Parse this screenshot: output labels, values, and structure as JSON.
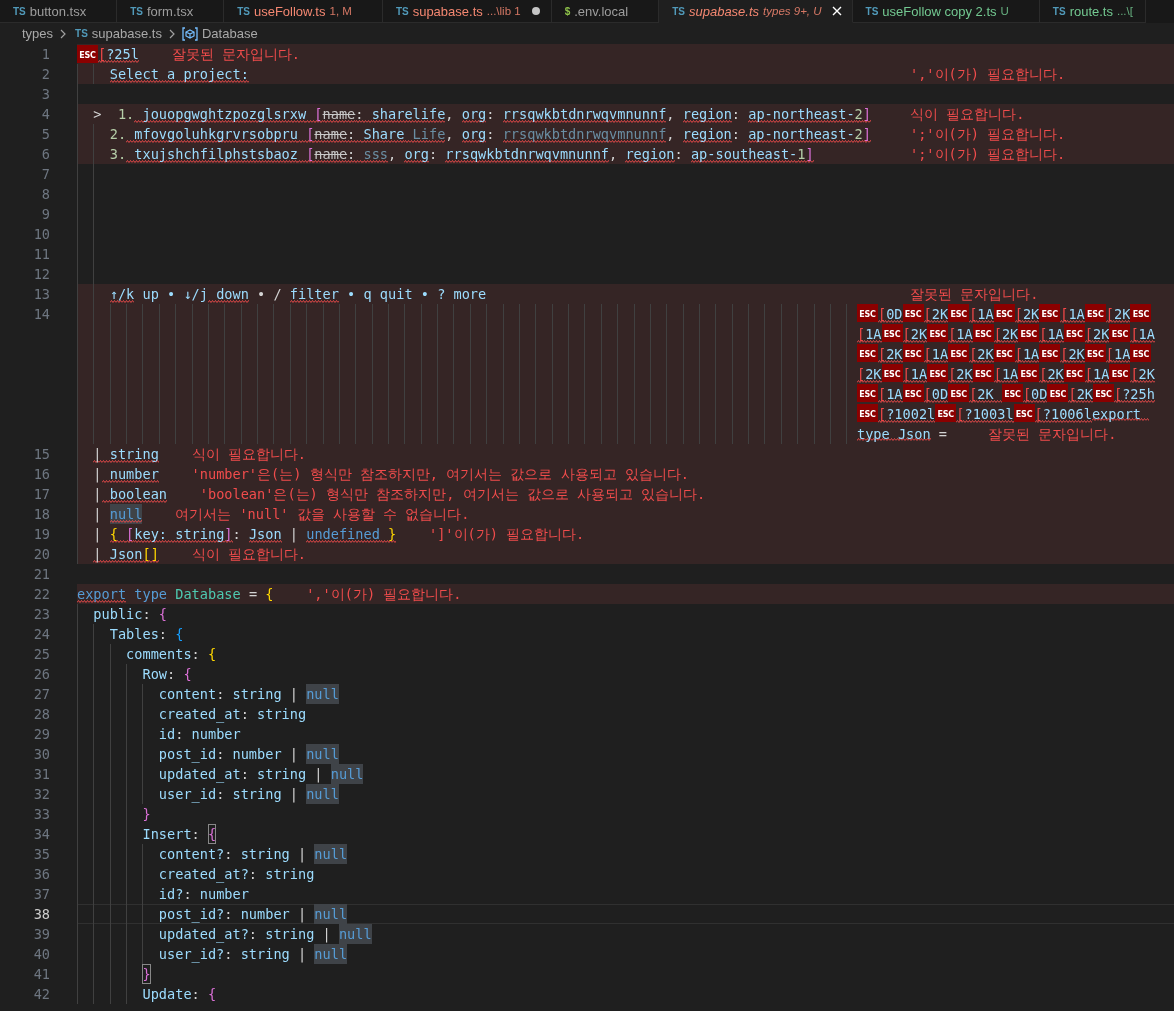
{
  "tabs": [
    {
      "icon": "TS",
      "kind": "ts",
      "label": "button.tsx",
      "color": "#9d9d9d",
      "dirty": false,
      "preview": false,
      "selected": false
    },
    {
      "icon": "TS",
      "kind": "ts",
      "label": "form.tsx",
      "color": "#9d9d9d",
      "dirty": false,
      "preview": false,
      "selected": false
    },
    {
      "icon": "TS",
      "kind": "ts",
      "label": "useFollow.ts",
      "detail": "1, M",
      "color": "#f48771",
      "dirty": false,
      "preview": false,
      "selected": false
    },
    {
      "icon": "TS",
      "kind": "ts",
      "label": "supabase.ts",
      "detail": "...\\lib 1",
      "color": "#f48771",
      "dirty": true,
      "preview": false,
      "selected": false
    },
    {
      "icon": "$",
      "kind": "shell",
      "label": ".env.local",
      "color": "#9d9d9d",
      "dirty": false,
      "preview": false,
      "selected": false
    },
    {
      "icon": "TS",
      "kind": "ts",
      "label": "supabase.ts",
      "detail": "types 9+, U",
      "color": "#f48771",
      "dirty": false,
      "preview": true,
      "selected": true
    },
    {
      "icon": "TS",
      "kind": "ts",
      "label": "useFollow copy 2.ts",
      "detail": "U",
      "color": "#73c991",
      "dirty": false,
      "preview": false,
      "selected": false
    },
    {
      "icon": "TS",
      "kind": "ts",
      "label": "route.ts",
      "detail": "...\\[",
      "color": "#73c991",
      "dirty": false,
      "preview": false,
      "selected": false
    }
  ],
  "breadcrumb": [
    {
      "kind": "folder",
      "label": "types"
    },
    {
      "kind": "file",
      "icon": "TS",
      "label": "supabase.ts"
    },
    {
      "kind": "symbol",
      "label": "Database"
    }
  ],
  "lines": [
    {
      "number": "1",
      "error": true,
      "current": false,
      "tokens": [
        {
          "kind": "escape",
          "control": "ESC",
          "text": "[?25l",
          "squiggle": true
        }
      ],
      "diagnostic": {
        "message": "잘못된 문자입니다.",
        "kind": "inline"
      }
    },
    {
      "number": "2",
      "error": true,
      "current": false,
      "tokens": [
        {
          "text": "    Select a project:",
          "kind": "name",
          "squiggle": true
        }
      ],
      "diagnostic": {
        "message": "','이(가) 필요합니다.",
        "kind": "end"
      }
    },
    {
      "number": "3",
      "error": false,
      "current": false
    },
    {
      "number": "4",
      "error": true,
      "current": false,
      "tokens": [
        {
          "text": "  >  ",
          "kind": "plain",
          "squiggle": false
        },
        {
          "text": "1.",
          "kind": "number",
          "squiggle": false
        },
        {
          "text": " jouopgwghtzpozglsrxw",
          "kind": "name",
          "squiggle": true
        },
        {
          "text": " [",
          "kind": "bracket",
          "squiggle": true
        },
        {
          "text": "name",
          "kind": "deprecated",
          "squiggle": true
        },
        {
          "text": ": ",
          "kind": "plain",
          "squiggle": true
        },
        {
          "text": "sharelife",
          "kind": "name",
          "squiggle": true
        },
        {
          "text": ", ",
          "kind": "plain",
          "squiggle": false
        },
        {
          "text": "org",
          "kind": "name",
          "squiggle": true
        },
        {
          "text": ": ",
          "kind": "plain",
          "squiggle": false
        },
        {
          "text": "rrsqwkbtdnrwqvmnunnf",
          "kind": "name",
          "squiggle": true
        },
        {
          "text": ", ",
          "kind": "plain",
          "squiggle": false
        },
        {
          "text": "region",
          "kind": "name",
          "squiggle": true
        },
        {
          "text": ": ",
          "kind": "plain",
          "squiggle": false
        },
        {
          "text": "ap-northeast-",
          "kind": "name",
          "squiggle": true
        },
        {
          "text": "2",
          "kind": "number",
          "squiggle": true
        },
        {
          "text": "]",
          "kind": "bracket",
          "squiggle": true
        }
      ],
      "diagnostic": {
        "message": "식이 필요합니다.",
        "kind": "end"
      }
    },
    {
      "number": "5",
      "error": true,
      "current": false,
      "tokens": [
        {
          "text": "    2.",
          "kind": "number",
          "squiggle": false
        },
        {
          "text": " mfovgoluhkgrvrsobpru",
          "kind": "name",
          "squiggle": true
        },
        {
          "text": " [",
          "kind": "bracket",
          "squiggle": true
        },
        {
          "text": "name",
          "kind": "deprecated",
          "squiggle": true
        },
        {
          "text": ": ",
          "kind": "plain",
          "squiggle": true
        },
        {
          "text": "Share",
          "kind": "name",
          "squiggle": true
        },
        {
          "text": " Life",
          "kind": "dim",
          "squiggle": true
        },
        {
          "text": ", ",
          "kind": "plain",
          "squiggle": false
        },
        {
          "text": "org",
          "kind": "name",
          "squiggle": true
        },
        {
          "text": ": ",
          "kind": "plain",
          "squiggle": false
        },
        {
          "text": "rrsqwkbtdnrwqvmnunnf",
          "kind": "dim",
          "squiggle": true
        },
        {
          "text": ", ",
          "kind": "plain",
          "squiggle": false
        },
        {
          "text": "region",
          "kind": "name",
          "squiggle": true
        },
        {
          "text": ": ",
          "kind": "plain",
          "squiggle": false
        },
        {
          "text": "ap-northeast-",
          "kind": "name",
          "squiggle": true
        },
        {
          "text": "2",
          "kind": "number",
          "squiggle": true
        },
        {
          "text": "]",
          "kind": "bracket",
          "squiggle": true
        }
      ],
      "diagnostic": {
        "message": "';'이(가) 필요합니다.",
        "kind": "end"
      }
    },
    {
      "number": "6",
      "error": true,
      "current": false,
      "tokens": [
        {
          "text": "    3.",
          "kind": "number",
          "squiggle": false
        },
        {
          "text": " txujshchfilphstsbaoz",
          "kind": "name",
          "squiggle": true
        },
        {
          "text": " [",
          "kind": "bracket",
          "squiggle": true
        },
        {
          "text": "name",
          "kind": "deprecated",
          "squiggle": true
        },
        {
          "text": ": ",
          "kind": "plain",
          "squiggle": true
        },
        {
          "text": "sss",
          "kind": "dim",
          "squiggle": true
        },
        {
          "text": ", ",
          "kind": "plain",
          "squiggle": false
        },
        {
          "text": "org",
          "kind": "name",
          "squiggle": true
        },
        {
          "text": ": ",
          "kind": "plain",
          "squiggle": false
        },
        {
          "text": "rrsqwkbtdnrwqvmnunnf",
          "kind": "name",
          "squiggle": true
        },
        {
          "text": ", ",
          "kind": "plain",
          "squiggle": false
        },
        {
          "text": "region",
          "kind": "name",
          "squiggle": true
        },
        {
          "text": ": ",
          "kind": "plain",
          "squiggle": false
        },
        {
          "text": "ap-southeast-",
          "kind": "name",
          "squiggle": true
        },
        {
          "text": "1",
          "kind": "number",
          "squiggle": true
        },
        {
          "text": "]",
          "kind": "bracket",
          "squiggle": true
        }
      ],
      "diagnostic": {
        "message": "';'이(가) 필요합니다.",
        "kind": "end"
      }
    },
    {
      "number": "7",
      "error": false,
      "current": false
    },
    {
      "number": "8",
      "error": false,
      "current": false
    },
    {
      "number": "9",
      "error": false,
      "current": false
    },
    {
      "number": "10",
      "error": false,
      "current": false
    },
    {
      "number": "11",
      "error": false,
      "current": false
    },
    {
      "number": "12",
      "error": false,
      "current": false
    },
    {
      "number": "13",
      "error": true,
      "current": false,
      "tokens": [
        {
          "text": "    ↑/k",
          "kind": "name",
          "squiggle": true
        },
        {
          "text": " up • ",
          "kind": "name",
          "squiggle": false
        },
        {
          "text": "↓/j",
          "kind": "name",
          "squiggle": false
        },
        {
          "text": " down",
          "kind": "name",
          "squiggle": true
        },
        {
          "text": " • / ",
          "kind": "plain",
          "squiggle": false
        },
        {
          "text": "filter",
          "kind": "name",
          "squiggle": true
        },
        {
          "text": " • q quit • ? more",
          "kind": "name",
          "squiggle": false
        }
      ],
      "diagnostic": {
        "message": "잘못된 문자입니다.",
        "kind": "end"
      }
    },
    {
      "number": "14",
      "error": true,
      "current": false,
      "wrapped": true,
      "tokens": [
        {
          "kind": "escape",
          "control": "ESC",
          "text": "[0D",
          "squiggle": true
        },
        {
          "kind": "escape",
          "control": "ESC",
          "text": "[2K",
          "squiggle": true
        },
        {
          "kind": "escape",
          "control": "ESC",
          "text": "[1A",
          "squiggle": true
        },
        {
          "kind": "escape",
          "control": "ESC",
          "text": "[2K",
          "squiggle": true
        },
        {
          "kind": "escape",
          "control": "ESC",
          "text": "[1A",
          "squiggle": true
        },
        {
          "kind": "escape",
          "control": "ESC",
          "text": "[2K",
          "squiggle": true
        },
        {
          "kind": "escape",
          "control": "ESC",
          "text": "[1A",
          "squiggle": true
        },
        {
          "kind": "escape",
          "control": "ESC",
          "text": "[2K",
          "squiggle": true
        },
        {
          "kind": "escape",
          "control": "ESC",
          "text": "[1A",
          "squiggle": true
        },
        {
          "kind": "escape",
          "control": "ESC",
          "text": "[2K",
          "squiggle": true
        },
        {
          "kind": "escape",
          "control": "ESC",
          "text": "[1A",
          "squiggle": true
        },
        {
          "kind": "escape",
          "control": "ESC",
          "text": "[2K",
          "squiggle": true
        },
        {
          "kind": "escape",
          "control": "ESC",
          "text": "[1A",
          "squiggle": true
        },
        {
          "kind": "escape",
          "control": "ESC",
          "text": "[2K",
          "squiggle": true
        },
        {
          "kind": "escape",
          "control": "ESC",
          "text": "[1A",
          "squiggle": true
        },
        {
          "kind": "escape",
          "control": "ESC",
          "text": "[2K",
          "squiggle": true
        },
        {
          "kind": "escape",
          "control": "ESC",
          "text": "[1A",
          "squiggle": true
        },
        {
          "kind": "escape",
          "control": "ESC",
          "text": "[2K",
          "squiggle": true
        },
        {
          "kind": "escape",
          "control": "ESC",
          "text": "[1A",
          "squiggle": true
        },
        {
          "kind": "escape",
          "control": "ESC",
          "text": "[2K",
          "squiggle": true
        },
        {
          "kind": "escape",
          "control": "ESC",
          "text": "[1A",
          "squiggle": true
        },
        {
          "kind": "escape",
          "control": "ESC",
          "text": "[2K",
          "squiggle": true
        },
        {
          "kind": "escape",
          "control": "ESC",
          "text": "[1A",
          "squiggle": true
        },
        {
          "kind": "escape",
          "control": "ESC",
          "text": "[2K",
          "squiggle": true
        },
        {
          "kind": "escape",
          "control": "ESC",
          "text": "[1A",
          "squiggle": true
        },
        {
          "kind": "escape",
          "control": "ESC",
          "text": "[2K",
          "squiggle": true
        },
        {
          "kind": "escape",
          "control": "ESC",
          "text": "[1A",
          "squiggle": true
        },
        {
          "kind": "escape",
          "control": "ESC",
          "text": "[0D",
          "squiggle": true
        },
        {
          "kind": "escape",
          "control": "ESC",
          "text": "[2K ",
          "squiggle": true
        },
        {
          "kind": "escape",
          "control": "ESC",
          "text": "[0D",
          "squiggle": true
        },
        {
          "kind": "escape",
          "control": "ESC",
          "text": "[2K",
          "squiggle": true
        },
        {
          "kind": "escape",
          "control": "ESC",
          "text": "[?25h",
          "squiggle": true
        },
        {
          "kind": "escape",
          "control": "ESC",
          "text": "[?1002l",
          "squiggle": true
        },
        {
          "kind": "escape",
          "control": "ESC",
          "text": "[?1003l",
          "squiggle": true
        },
        {
          "kind": "escape",
          "control": "ESC",
          "text": "[?1006l",
          "squiggle": true
        },
        {
          "text": "export type Json",
          "kind": "name",
          "squiggle": true
        },
        {
          "text": " =",
          "kind": "plain",
          "squiggle": false
        }
      ],
      "diagnostic": {
        "message": "잘못된 문자입니다.",
        "kind": "inline"
      }
    },
    {
      "number": "15",
      "error": true,
      "current": false,
      "tokens": [
        {
          "text": "  |",
          "kind": "plain",
          "squiggle": true
        },
        {
          "text": " string",
          "kind": "name",
          "squiggle": true
        }
      ],
      "diagnostic": {
        "message": "식이 필요합니다.",
        "kind": "inline"
      }
    },
    {
      "number": "16",
      "error": true,
      "current": false,
      "tokens": [
        {
          "text": "  |",
          "kind": "plain",
          "squiggle": false
        },
        {
          "text": " number",
          "kind": "name",
          "squiggle": true
        }
      ],
      "diagnostic": {
        "message": "'number'은(는) 형식만 참조하지만, 여기서는 값으로 사용되고 있습니다.",
        "kind": "inline"
      }
    },
    {
      "number": "17",
      "error": true,
      "current": false,
      "tokens": [
        {
          "text": "  |",
          "kind": "plain",
          "squiggle": false
        },
        {
          "text": " boolean",
          "kind": "name",
          "squiggle": true
        }
      ],
      "diagnostic": {
        "message": "'boolean'은(는) 형식만 참조하지만, 여기서는 값으로 사용되고 있습니다.",
        "kind": "inline"
      }
    },
    {
      "number": "18",
      "error": true,
      "current": false,
      "tokens": [
        {
          "text": "  | ",
          "kind": "plain",
          "squiggle": false
        },
        {
          "text": "null",
          "kind": "nullref",
          "squiggle": true
        }
      ],
      "diagnostic": {
        "message": "여기서는 'null' 값을 사용할 수 없습니다.",
        "kind": "inline"
      }
    },
    {
      "number": "19",
      "error": true,
      "current": false,
      "tokens": [
        {
          "text": "  | ",
          "kind": "plain",
          "squiggle": false
        },
        {
          "text": "{ ",
          "kind": "brace1",
          "squiggle": true
        },
        {
          "text": "[",
          "kind": "brace2",
          "squiggle": true
        },
        {
          "text": "key: string",
          "kind": "name",
          "squiggle": true
        },
        {
          "text": "]",
          "kind": "brace2",
          "squiggle": true
        },
        {
          "text": ": ",
          "kind": "plain",
          "squiggle": false
        },
        {
          "text": "Json",
          "kind": "name",
          "squiggle": true
        },
        {
          "text": " | ",
          "kind": "plain",
          "squiggle": false
        },
        {
          "text": "undefined",
          "kind": "keyword",
          "squiggle": true
        },
        {
          "text": " }",
          "kind": "brace1",
          "squiggle": true
        }
      ],
      "diagnostic": {
        "message": "']'이(가) 필요합니다.",
        "kind": "inline"
      }
    },
    {
      "number": "20",
      "error": true,
      "current": false,
      "tokens": [
        {
          "text": "  |",
          "kind": "plain",
          "squiggle": true
        },
        {
          "text": " Json",
          "kind": "name",
          "squiggle": true
        },
        {
          "text": "[]",
          "kind": "brace1",
          "squiggle": true
        }
      ],
      "diagnostic": {
        "message": "식이 필요합니다.",
        "kind": "inline"
      }
    },
    {
      "number": "21",
      "error": false,
      "current": false
    },
    {
      "number": "22",
      "error": true,
      "current": false,
      "tokens": [
        {
          "text": "export",
          "kind": "keyword",
          "squiggle": true
        },
        {
          "text": " type",
          "kind": "keyword",
          "squiggle": false
        },
        {
          "text": " Database",
          "kind": "type",
          "squiggle": false
        },
        {
          "text": " = ",
          "kind": "plain",
          "squiggle": false
        },
        {
          "text": "{",
          "kind": "brace1",
          "squiggle": false
        }
      ],
      "diagnostic": {
        "message": "','이(가) 필요합니다.",
        "kind": "inline"
      }
    },
    {
      "number": "23",
      "error": false,
      "current": false,
      "tokens": [
        {
          "text": "  public",
          "kind": "name",
          "squiggle": false
        },
        {
          "text": ": ",
          "kind": "plain",
          "squiggle": false
        },
        {
          "text": "{",
          "kind": "brace2",
          "squiggle": false
        }
      ]
    },
    {
      "number": "24",
      "error": false,
      "current": false,
      "tokens": [
        {
          "text": "    Tables",
          "kind": "name",
          "squiggle": false
        },
        {
          "text": ": ",
          "kind": "plain",
          "squiggle": false
        },
        {
          "text": "{",
          "kind": "brace3",
          "squiggle": false
        }
      ]
    },
    {
      "number": "25",
      "error": false,
      "current": false,
      "tokens": [
        {
          "text": "      comments",
          "kind": "name",
          "squiggle": false
        },
        {
          "text": ": ",
          "kind": "plain",
          "squiggle": false
        },
        {
          "text": "{",
          "kind": "brace1",
          "squiggle": false
        }
      ]
    },
    {
      "number": "26",
      "error": false,
      "current": false,
      "tokens": [
        {
          "text": "        Row",
          "kind": "name",
          "squiggle": false
        },
        {
          "text": ": ",
          "kind": "plain",
          "squiggle": false
        },
        {
          "text": "{",
          "kind": "brace2",
          "squiggle": false
        }
      ]
    },
    {
      "number": "27",
      "error": false,
      "current": false,
      "tokens": [
        {
          "text": "          content",
          "kind": "name",
          "squiggle": false
        },
        {
          "text": ": ",
          "kind": "plain",
          "squiggle": false
        },
        {
          "text": "string",
          "kind": "name",
          "squiggle": false
        },
        {
          "text": " | ",
          "kind": "plain",
          "squiggle": false
        },
        {
          "text": "null",
          "kind": "nullref",
          "squiggle": false
        }
      ]
    },
    {
      "number": "28",
      "error": false,
      "current": false,
      "tokens": [
        {
          "text": "          created_at",
          "kind": "name",
          "squiggle": false
        },
        {
          "text": ": ",
          "kind": "plain",
          "squiggle": false
        },
        {
          "text": "string",
          "kind": "name",
          "squiggle": false
        }
      ]
    },
    {
      "number": "29",
      "error": false,
      "current": false,
      "tokens": [
        {
          "text": "          id",
          "kind": "name",
          "squiggle": false
        },
        {
          "text": ": ",
          "kind": "plain",
          "squiggle": false
        },
        {
          "text": "number",
          "kind": "name",
          "squiggle": false
        }
      ]
    },
    {
      "number": "30",
      "error": false,
      "current": false,
      "tokens": [
        {
          "text": "          post_id",
          "kind": "name",
          "squiggle": false
        },
        {
          "text": ": ",
          "kind": "plain",
          "squiggle": false
        },
        {
          "text": "number",
          "kind": "name",
          "squiggle": false
        },
        {
          "text": " | ",
          "kind": "plain",
          "squiggle": false
        },
        {
          "text": "null",
          "kind": "nullref",
          "squiggle": false
        }
      ]
    },
    {
      "number": "31",
      "error": false,
      "current": false,
      "tokens": [
        {
          "text": "          updated_at",
          "kind": "name",
          "squiggle": false
        },
        {
          "text": ": ",
          "kind": "plain",
          "squiggle": false
        },
        {
          "text": "string",
          "kind": "name",
          "squiggle": false
        },
        {
          "text": " | ",
          "kind": "plain",
          "squiggle": false
        },
        {
          "text": "null",
          "kind": "nullref",
          "squiggle": false
        }
      ]
    },
    {
      "number": "32",
      "error": false,
      "current": false,
      "tokens": [
        {
          "text": "          user_id",
          "kind": "name",
          "squiggle": false
        },
        {
          "text": ": ",
          "kind": "plain",
          "squiggle": false
        },
        {
          "text": "string",
          "kind": "name",
          "squiggle": false
        },
        {
          "text": " | ",
          "kind": "plain",
          "squiggle": false
        },
        {
          "text": "null",
          "kind": "nullref",
          "squiggle": false
        }
      ]
    },
    {
      "number": "33",
      "error": false,
      "current": false,
      "tokens": [
        {
          "text": "        }",
          "kind": "brace2",
          "squiggle": false
        }
      ]
    },
    {
      "number": "34",
      "error": false,
      "current": false,
      "tokens": [
        {
          "text": "        Insert",
          "kind": "name",
          "squiggle": false
        },
        {
          "text": ": ",
          "kind": "plain",
          "squiggle": false
        },
        {
          "text": "{",
          "kind": "boxed",
          "squiggle": false
        }
      ]
    },
    {
      "number": "35",
      "error": false,
      "current": false,
      "tokens": [
        {
          "text": "          content?",
          "kind": "name",
          "squiggle": false
        },
        {
          "text": ": ",
          "kind": "plain",
          "squiggle": false
        },
        {
          "text": "string",
          "kind": "name",
          "squiggle": false
        },
        {
          "text": " | ",
          "kind": "plain",
          "squiggle": false
        },
        {
          "text": "null",
          "kind": "nullref",
          "squiggle": false
        }
      ]
    },
    {
      "number": "36",
      "error": false,
      "current": false,
      "tokens": [
        {
          "text": "          created_at?",
          "kind": "name",
          "squiggle": false
        },
        {
          "text": ": ",
          "kind": "plain",
          "squiggle": false
        },
        {
          "text": "string",
          "kind": "name",
          "squiggle": false
        }
      ]
    },
    {
      "number": "37",
      "error": false,
      "current": false,
      "tokens": [
        {
          "text": "          id?",
          "kind": "name",
          "squiggle": false
        },
        {
          "text": ": ",
          "kind": "plain",
          "squiggle": false
        },
        {
          "text": "number",
          "kind": "name",
          "squiggle": false
        }
      ]
    },
    {
      "number": "38",
      "error": false,
      "current": true,
      "tokens": [
        {
          "text": "          post_id?",
          "kind": "name",
          "squiggle": false
        },
        {
          "text": ": ",
          "kind": "plain",
          "squiggle": false
        },
        {
          "text": "number",
          "kind": "name",
          "squiggle": false
        },
        {
          "text": " | ",
          "kind": "plain",
          "squiggle": false
        },
        {
          "text": "null",
          "kind": "nullref",
          "squiggle": false
        }
      ]
    },
    {
      "number": "39",
      "error": false,
      "current": false,
      "tokens": [
        {
          "text": "          updated_at?",
          "kind": "name",
          "squiggle": false
        },
        {
          "text": ": ",
          "kind": "plain",
          "squiggle": false
        },
        {
          "text": "string",
          "kind": "name",
          "squiggle": false
        },
        {
          "text": " | ",
          "kind": "plain",
          "squiggle": false
        },
        {
          "text": "null",
          "kind": "nullref",
          "squiggle": false
        }
      ]
    },
    {
      "number": "40",
      "error": false,
      "current": false,
      "tokens": [
        {
          "text": "          user_id?",
          "kind": "name",
          "squiggle": false
        },
        {
          "text": ": ",
          "kind": "plain",
          "squiggle": false
        },
        {
          "text": "string",
          "kind": "name",
          "squiggle": false
        },
        {
          "text": " | ",
          "kind": "plain",
          "squiggle": false
        },
        {
          "text": "null",
          "kind": "nullref",
          "squiggle": false
        }
      ]
    },
    {
      "number": "41",
      "error": false,
      "current": false,
      "tokens": [
        {
          "text": "        }",
          "kind": "boxed",
          "squiggle": false
        }
      ]
    },
    {
      "number": "42",
      "error": false,
      "current": false,
      "tokens": [
        {
          "text": "        Update",
          "kind": "name",
          "squiggle": false
        },
        {
          "text": ": ",
          "kind": "plain",
          "squiggle": false
        },
        {
          "text": "{",
          "kind": "brace2",
          "squiggle": false
        }
      ]
    }
  ]
}
